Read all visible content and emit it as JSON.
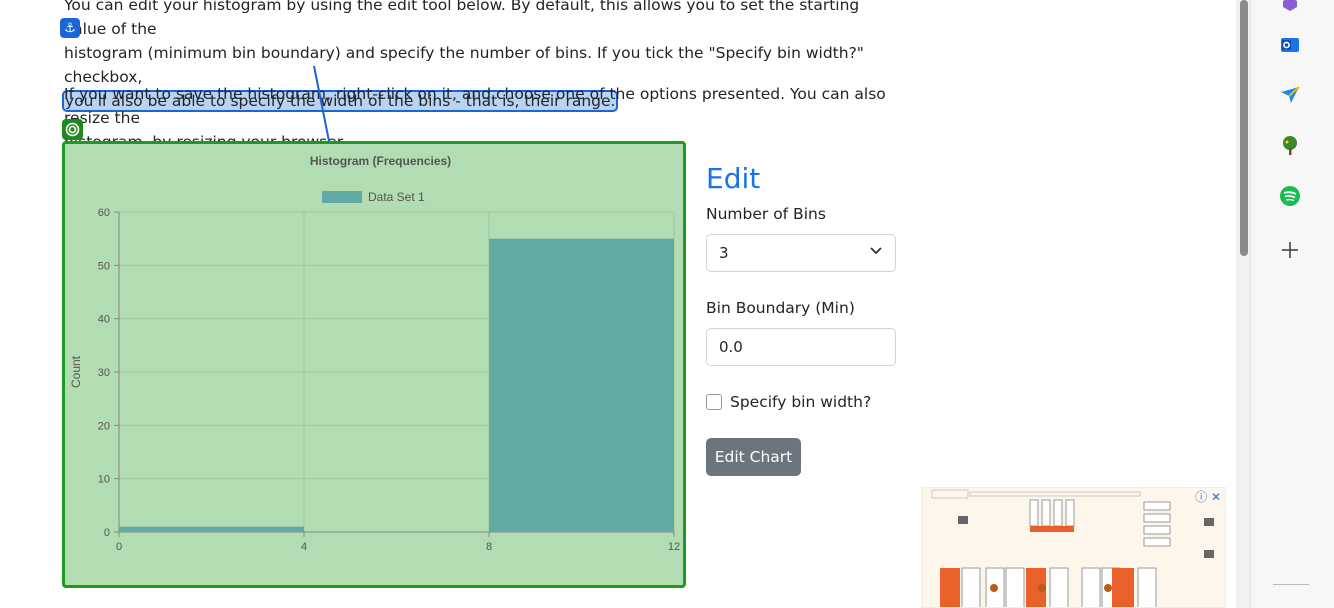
{
  "text": {
    "para1_line1": "You can edit your histogram by using the edit tool below. By default, this allows you to set the starting value of the",
    "para1_line2": "histogram (minimum bin boundary) and specify the number of bins. If you tick the \"Specify bin width?\" checkbox,",
    "para1_highlight": "you'll also be able to specify the width of the bins - that is, their range.",
    "para2_line1": "If you want to save the histogram, right-click on it, and choose one of the options presented. You can also resize the",
    "para2_line2": "histogram, by resizing your browser."
  },
  "badges": {
    "anchor": "⚓",
    "target": "◎"
  },
  "edit": {
    "title": "Edit",
    "bins_label": "Number of Bins",
    "bins_value": "3",
    "min_label": "Bin Boundary (Min)",
    "min_value": "0.0",
    "width_checkbox_label": "Specify bin width?",
    "button_label": "Edit Chart"
  },
  "chart_data": {
    "type": "bar",
    "title": "Histogram (Frequencies)",
    "ylabel": "Count",
    "xlabel": "",
    "x_ticks": [
      0,
      4,
      8,
      12
    ],
    "y_ticks": [
      0,
      10,
      20,
      30,
      40,
      50,
      60
    ],
    "xlim": [
      0,
      12
    ],
    "ylim": [
      0,
      60
    ],
    "legend": "top",
    "series": [
      {
        "name": "Data Set 1",
        "color": "#62aba5",
        "bins": [
          {
            "x0": 0,
            "x1": 4,
            "value": 1
          },
          {
            "x0": 4,
            "x1": 8,
            "value": 0
          },
          {
            "x0": 8,
            "x1": 12,
            "value": 55
          }
        ]
      }
    ]
  },
  "sidebar": {
    "icons": [
      "copilot-icon",
      "outlook-icon",
      "send-icon",
      "tree-icon",
      "spotify-icon",
      "add-icon"
    ]
  },
  "colors": {
    "accent": "#1a73e8",
    "highlight": "#1a66d6",
    "chart_bg": "#b2dcb2",
    "chart_border": "#1e9a1e",
    "button": "#6c757d"
  }
}
